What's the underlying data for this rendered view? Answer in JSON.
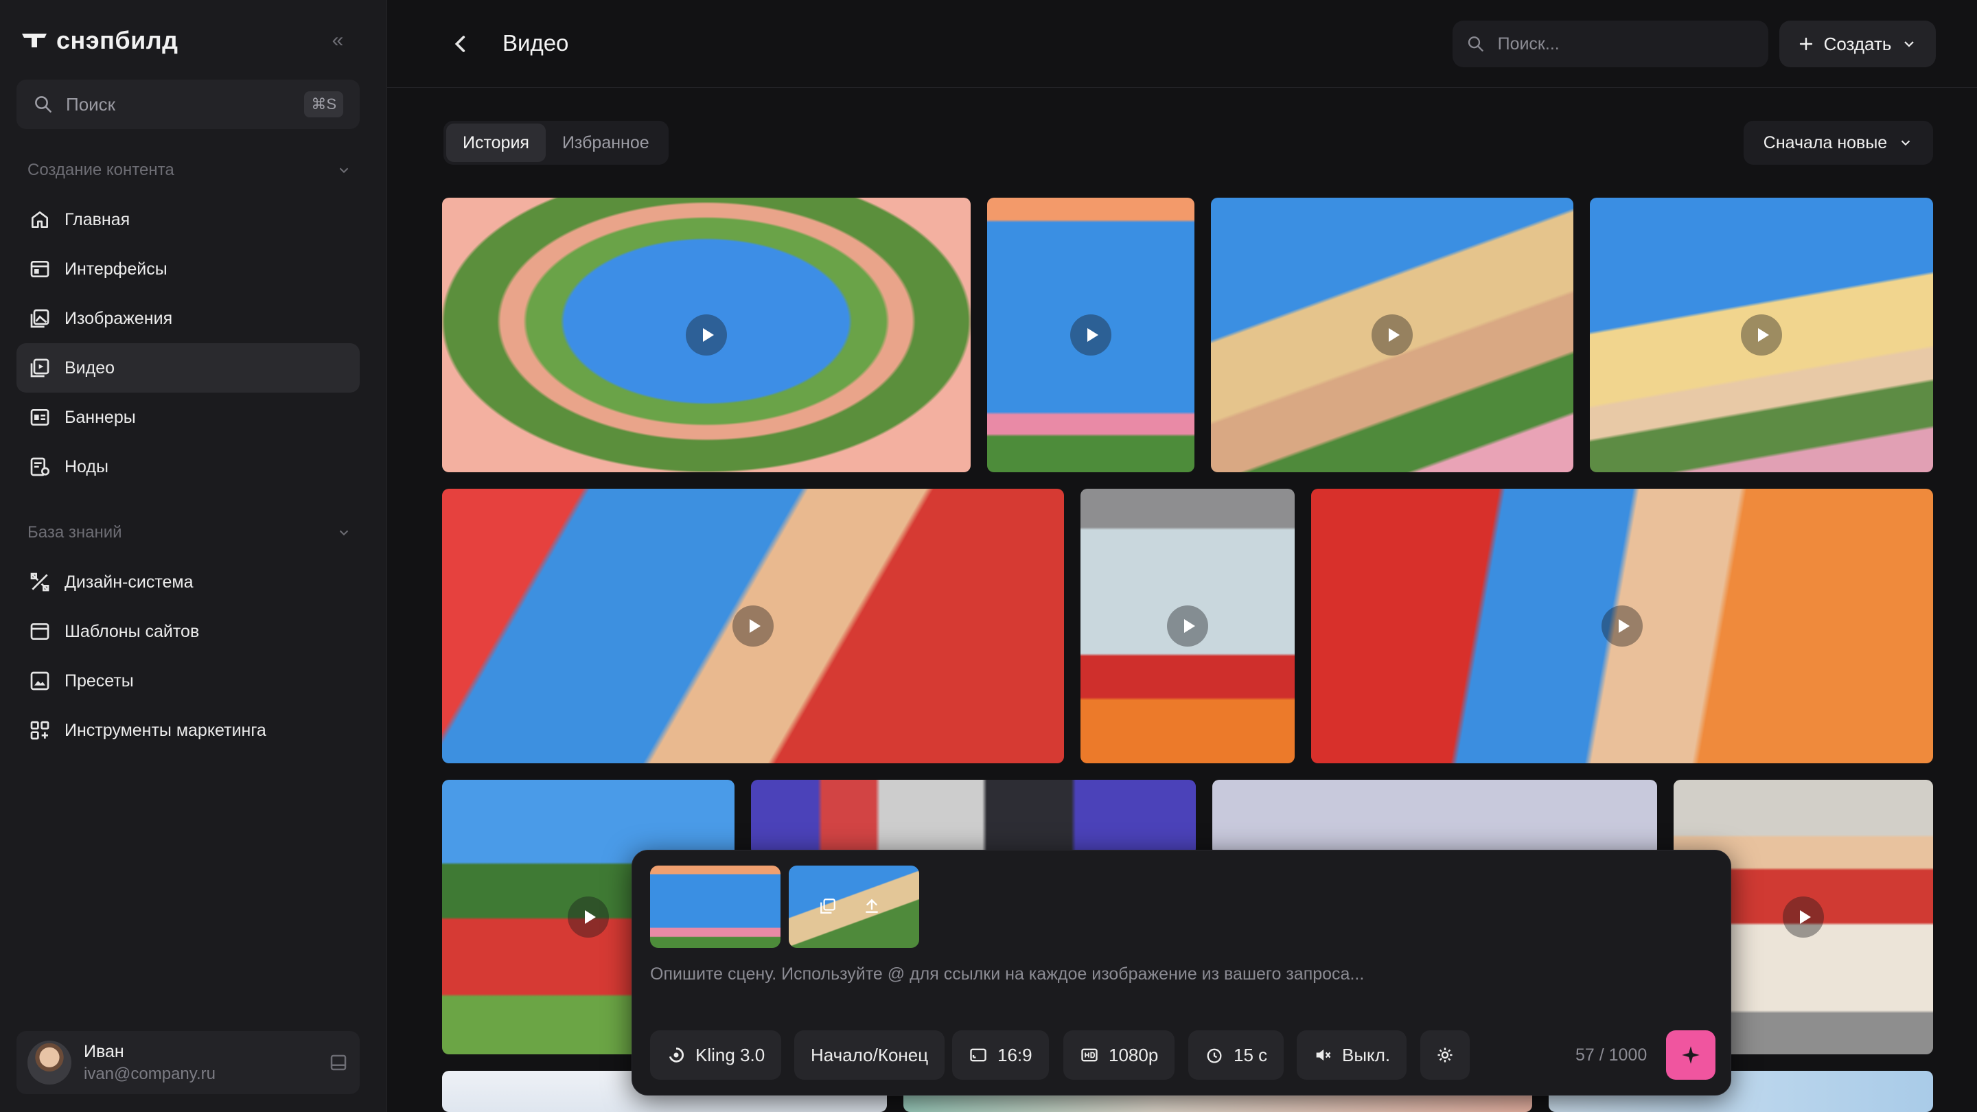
{
  "brand": {
    "name": "снэпбилд"
  },
  "sidebar": {
    "search_placeholder": "Поиск",
    "search_shortcut": "⌘S",
    "section_content": "Создание контента",
    "content_items": [
      {
        "label": "Главная",
        "icon": "home-icon"
      },
      {
        "label": "Интерфейсы",
        "icon": "layout-icon"
      },
      {
        "label": "Изображения",
        "icon": "images-icon"
      },
      {
        "label": "Видео",
        "icon": "video-icon",
        "active": true
      },
      {
        "label": "Баннеры",
        "icon": "banner-icon"
      },
      {
        "label": "Ноды",
        "icon": "nodes-icon"
      }
    ],
    "section_knowledge": "База знаний",
    "knowledge_items": [
      {
        "label": "Дизайн-система",
        "icon": "design-tools-icon"
      },
      {
        "label": "Шаблоны сайтов",
        "icon": "browser-window-icon"
      },
      {
        "label": "Пресеты",
        "icon": "preset-image-icon"
      },
      {
        "label": "Инструменты маркетинга",
        "icon": "grid-plus-icon"
      }
    ],
    "user": {
      "name": "Иван",
      "email": "ivan@company.ru"
    }
  },
  "header": {
    "title": "Видео",
    "search_placeholder": "Поиск...",
    "create_label": "Создать"
  },
  "tabs": [
    {
      "label": "История",
      "active": true
    },
    {
      "label": "Избранное",
      "active": false
    }
  ],
  "sort": {
    "label": "Сначала новые"
  },
  "composer": {
    "placeholder": "Опишите сцену. Используйте @ для ссылки на каждое изображение из вашего запроса...",
    "model": "Kling 3.0",
    "mode": "Начало/Конец",
    "aspect": "16:9",
    "resolution": "1080p",
    "duration": "15 с",
    "sound": "Выкл.",
    "counter": "57 / 1000"
  },
  "colors": {
    "accent": "#f0559f",
    "background": "#121214",
    "sidebar": "#1b1b1e"
  }
}
